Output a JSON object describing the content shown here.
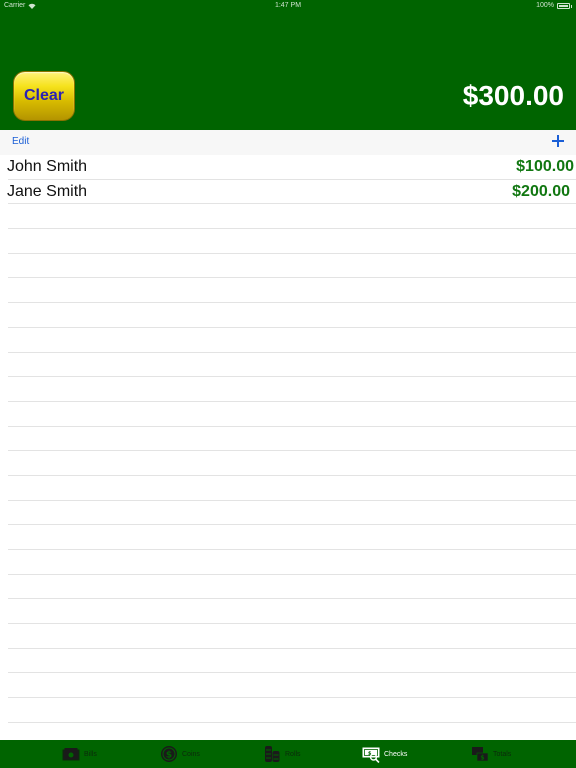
{
  "status_bar": {
    "carrier": "Carrier",
    "time": "1:47 PM",
    "battery": "100%"
  },
  "header": {
    "clear_label": "Clear",
    "grand_total": "$300.00",
    "background_color": "#006400"
  },
  "toolbar": {
    "edit_label": "Edit",
    "add_icon": "plus-icon"
  },
  "checks": [
    {
      "name": "John Smith",
      "amount": "$100.00"
    },
    {
      "name": "Jane Smith",
      "amount": "$200.00"
    }
  ],
  "tabbar": {
    "tabs": [
      {
        "label": "Bills",
        "icon": "bills-icon"
      },
      {
        "label": "Coins",
        "icon": "coins-icon"
      },
      {
        "label": "Rolls",
        "icon": "rolls-icon"
      },
      {
        "label": "Checks",
        "icon": "checks-icon",
        "active": true
      },
      {
        "label": "Totals",
        "icon": "totals-icon"
      }
    ]
  }
}
